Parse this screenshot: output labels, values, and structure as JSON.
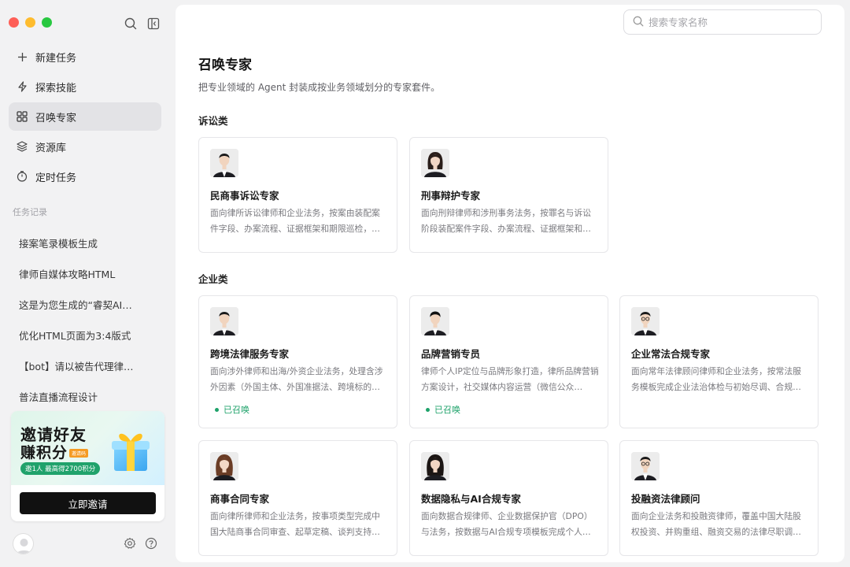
{
  "sidebar": {
    "nav": [
      {
        "label": "新建任务",
        "icon": "plus-icon"
      },
      {
        "label": "探索技能",
        "icon": "lightning-icon"
      },
      {
        "label": "召唤专家",
        "icon": "grid-icon",
        "active": true
      },
      {
        "label": "资源库",
        "icon": "layers-icon"
      },
      {
        "label": "定时任务",
        "icon": "clock-icon"
      }
    ],
    "history_title": "任务记录",
    "history": [
      "接案笔录模板生成",
      "律师自媒体攻略HTML",
      "这是为您生成的“睿契AI…",
      "优化HTML页面为3:4版式",
      "【bot】请以被告代理律…",
      "普法直播流程设计"
    ],
    "promo": {
      "line1": "邀请好友",
      "line2": "赚积分",
      "badge": "邀请码",
      "pill": "邀1人 最高得2700积分",
      "button": "立即邀请"
    }
  },
  "search": {
    "placeholder": "搜索专家名称"
  },
  "main": {
    "title": "召唤专家",
    "desc": "把专业领域的 Agent 封装成按业务领域划分的专家套件。",
    "categories": [
      {
        "name": "诉讼类",
        "cards": [
          {
            "name": "民商事诉讼专家",
            "desc": "面向律所诉讼律师和企业法务，按案由装配案件字段、办案流程、证据框架和期限巡检，…",
            "avatar": "male-suit-avatar"
          },
          {
            "name": "刑事辩护专家",
            "desc": "面向刑辩律师和涉刑事务法务，按罪名与诉讼阶段装配案件字段、办案流程、证据框架和…",
            "avatar": "female-suit-avatar"
          }
        ]
      },
      {
        "name": "企业类",
        "cards": [
          {
            "name": "跨境法律服务专家",
            "desc": "面向涉外律师和出海/外资企业法务，处理含涉外因素（外国主体、外国准据法、跨境标的…",
            "status": "已召唤",
            "avatar": "male-suit-avatar"
          },
          {
            "name": "品牌营销专员",
            "desc": "律师个人IP定位与品牌形象打造，律所品牌营销方案设计，社交媒体内容运营（微信公众…",
            "status": "已召唤",
            "avatar": "male-suit-avatar"
          },
          {
            "name": "企业常法合规专家",
            "desc": "面向常年法律顾问律师和企业法务，按常法服务模板完成企业法治体检与初始尽调、合规…",
            "avatar": "male-glasses-avatar"
          },
          {
            "name": "商事合同专家",
            "desc": "面向律所律师和企业法务，按事项类型完成中国大陆商事合同审查、起草定稿、谈判支持…",
            "avatar": "female-suit-avatar"
          },
          {
            "name": "数据隐私与AI合规专家",
            "desc": "面向数据合规律师、企业数据保护官（DPO）与法务，按数据与AI合规专项模板完成个人…",
            "avatar": "female-suit-avatar"
          },
          {
            "name": "投融资法律顾问",
            "desc": "面向企业法务和投融资律师，覆盖中国大陆股权投资、并购重组、融资交易的法律尽职调…",
            "avatar": "male-glasses-avatar"
          }
        ]
      }
    ]
  }
}
